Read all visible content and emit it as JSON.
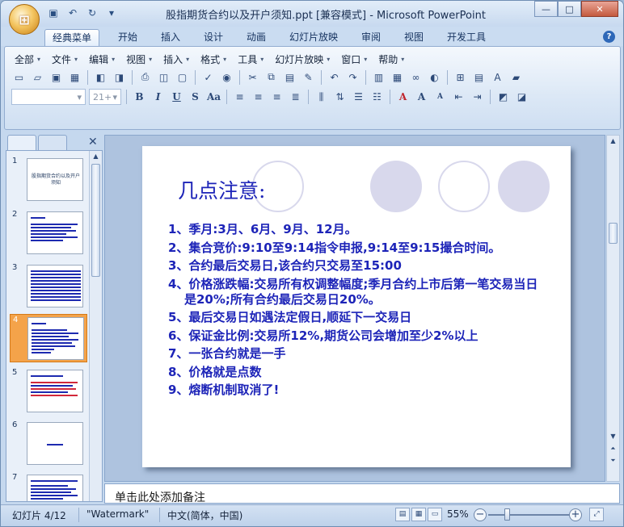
{
  "window": {
    "title": "股指期货合约以及开户须知.ppt [兼容模式] - Microsoft PowerPoint",
    "minimize_label": "—",
    "maximize_label": "□",
    "close_label": "✕"
  },
  "ribbon_tabs": [
    "经典菜单",
    "开始",
    "插入",
    "设计",
    "动画",
    "幻灯片放映",
    "审阅",
    "视图",
    "开发工具"
  ],
  "menus": [
    "全部",
    "文件",
    "编辑",
    "视图",
    "插入",
    "格式",
    "工具",
    "幻灯片放映",
    "窗口",
    "帮助"
  ],
  "font": {
    "size_value": "21+"
  },
  "thumbnails": [
    {
      "number": "1",
      "caption": "股指期货合约以及开户须知"
    },
    {
      "number": "2",
      "caption": ""
    },
    {
      "number": "3",
      "caption": ""
    },
    {
      "number": "4",
      "caption": ""
    },
    {
      "number": "5",
      "caption": ""
    },
    {
      "number": "6",
      "caption": ""
    },
    {
      "number": "7",
      "caption": ""
    }
  ],
  "slide": {
    "title": "几点注意:",
    "items": [
      "1、季月:3月、6月、9月、12月。",
      "2、集合竞价:9:10至9:14指令申报,9:14至9:15撮合时间。",
      "3、合约最后交易日,该合约只交易至15:00",
      "4、价格涨跌幅:交易所有权调整幅度;季月合约上市后第一笔交易当日是20%;所有合约最后交易日20%。",
      "5、最后交易日如遇法定假日,顺延下一交易日",
      "6、保证金比例:交易所12%,期货公司会增加至少2%以上",
      "7、一张合约就是一手",
      "8、价格就是点数",
      "9、熔断机制取消了!"
    ]
  },
  "notes": {
    "placeholder": "单击此处添加备注"
  },
  "status": {
    "slide_indicator": "幻灯片 4/12",
    "theme": "\"Watermark\"",
    "language": "中文(简体，中国)",
    "zoom": "55%"
  }
}
